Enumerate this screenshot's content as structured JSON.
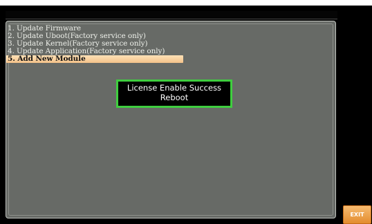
{
  "colors": {
    "screen_background": "#000000",
    "panel_background": "#676a66",
    "menu_text": "#eef0ea",
    "selected_highlight": "#f4c289",
    "dialog_border": "#3fce3f",
    "exit_button": "#e38c2e"
  },
  "menu": {
    "items": [
      {
        "label": "1. Update Firmware"
      },
      {
        "label": "2. Update Uboot(Factory service only)"
      },
      {
        "label": "3. Update Kernel(Factory service only)"
      },
      {
        "label": "4. Update Application(Factory service only)"
      },
      {
        "label": "5. Add New Module",
        "selected": true
      }
    ]
  },
  "dialog": {
    "line1": "License Enable Success",
    "line2": "Reboot"
  },
  "softkeys": {
    "exit_label": "EXIT"
  }
}
